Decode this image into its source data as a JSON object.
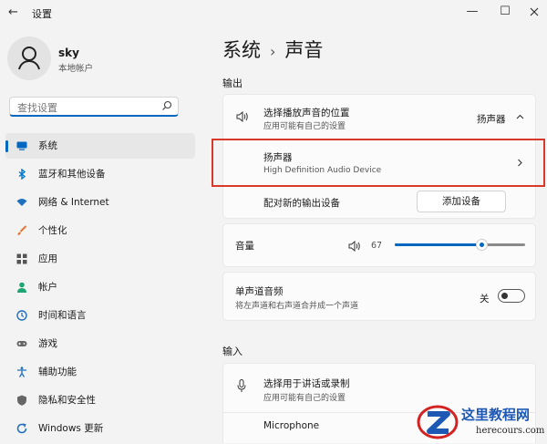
{
  "window": {
    "title": "设置",
    "back_glyph": "←",
    "minimize_glyph": "—",
    "maximize_glyph": "☐"
  },
  "user": {
    "name": "sky",
    "account": "本地帐户"
  },
  "search": {
    "placeholder": "查找设置"
  },
  "nav": [
    {
      "label": "系统",
      "icon": "monitor-icon",
      "color": "#0067c0",
      "active": true
    },
    {
      "label": "蓝牙和其他设备",
      "icon": "bluetooth-icon",
      "color": "#0078d4"
    },
    {
      "label": "网络 & Internet",
      "icon": "wifi-icon",
      "color": "#1f6fbf"
    },
    {
      "label": "个性化",
      "icon": "brush-icon",
      "color": "#e0783a"
    },
    {
      "label": "应用",
      "icon": "apps-icon",
      "color": "#555555"
    },
    {
      "label": "帐户",
      "icon": "account-icon",
      "color": "#1ea672"
    },
    {
      "label": "时间和语言",
      "icon": "globe-clock-icon",
      "color": "#1f6fbf"
    },
    {
      "label": "游戏",
      "icon": "gamepad-icon",
      "color": "#666666"
    },
    {
      "label": "辅助功能",
      "icon": "accessibility-icon",
      "color": "#1f6fbf"
    },
    {
      "label": "隐私和安全性",
      "icon": "shield-icon",
      "color": "#666666"
    },
    {
      "label": "Windows 更新",
      "icon": "update-icon",
      "color": "#1f6fbf"
    }
  ],
  "breadcrumb": {
    "parent": "系统",
    "separator": "›",
    "current": "声音"
  },
  "output": {
    "section_title": "输出",
    "choose_title": "选择播放声音的位置",
    "choose_sub": "应用可能有自己的设置",
    "choose_value": "扬声器",
    "device_name": "扬声器",
    "device_sub": "High Definition Audio Device",
    "pair_label": "配对新的输出设备",
    "add_device_button": "添加设备",
    "volume_label": "音量",
    "volume_value": "67",
    "volume": 67,
    "mono_title": "单声道音频",
    "mono_sub": "将左声道和右声道合并成一个声道",
    "mono_state": "关"
  },
  "input": {
    "section_title": "输入",
    "choose_title": "选择用于讲话或录制",
    "choose_sub": "应用可能有自己的设置",
    "device_name": "Microphone"
  },
  "watermark": {
    "text": "这里教程网",
    "url": "herecours.com"
  },
  "colors": {
    "accent": "#0067c0",
    "highlight_box": "#d9392a"
  }
}
